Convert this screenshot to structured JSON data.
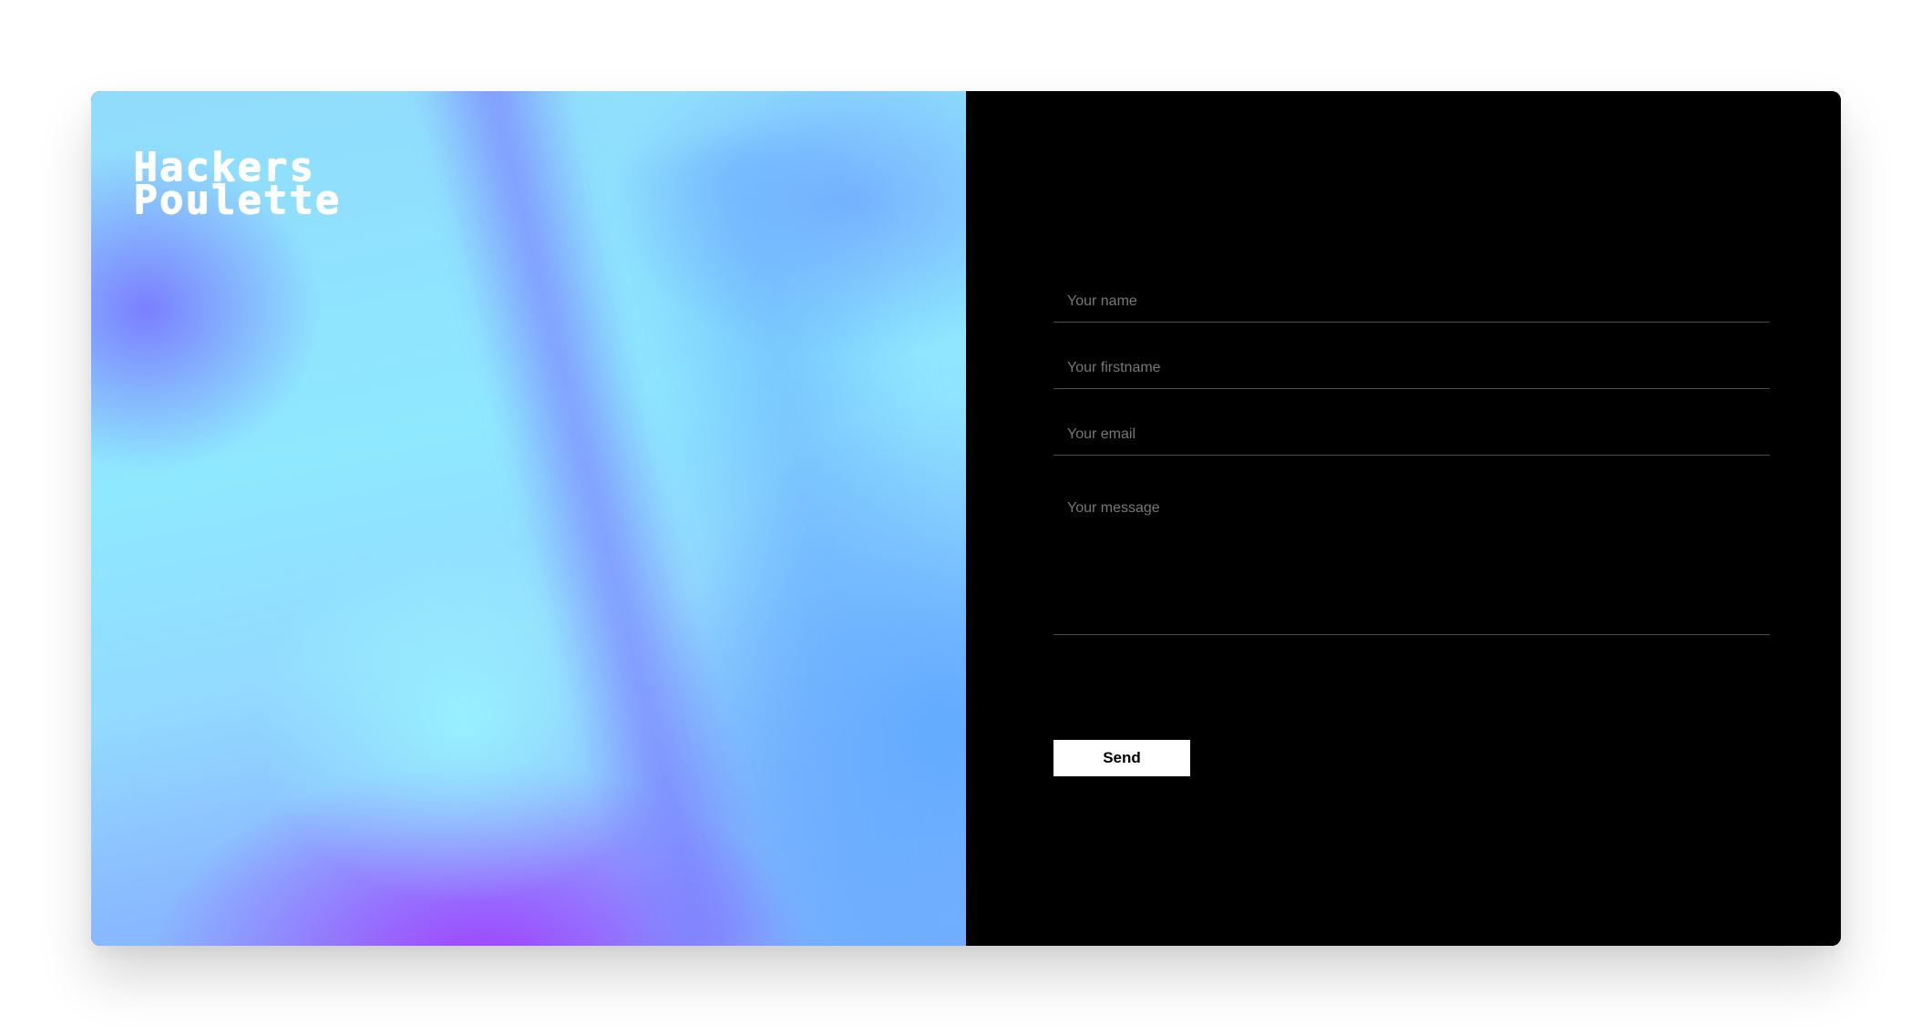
{
  "brand": {
    "lines": [
      "Hackers",
      "Poulette"
    ]
  },
  "form": {
    "fields": [
      {
        "placeholder": "Your name",
        "value": ""
      },
      {
        "placeholder": "Your firstname",
        "value": ""
      },
      {
        "placeholder": "Your email",
        "value": ""
      },
      {
        "placeholder": "Your message",
        "value": ""
      }
    ],
    "submit_label": "Send"
  },
  "colors": {
    "page_background": "#ffffff",
    "form_panel": "#000000",
    "button_background": "#ffffff",
    "button_text": "#000000",
    "placeholder_text": "#777777",
    "input_border": "#4c4c4c",
    "hero_gradient": [
      "#91dbfc",
      "#8ee8ff",
      "#89b9ff",
      "#a23aff"
    ]
  }
}
